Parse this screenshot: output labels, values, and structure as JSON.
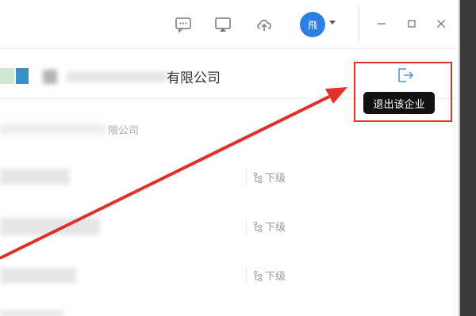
{
  "titlebar": {
    "icons": [
      "chat-icon",
      "screen-share-icon",
      "cloud-upload-icon"
    ],
    "avatar_text": "飛",
    "window_buttons": [
      "minimize-icon",
      "maximize-icon",
      "close-icon"
    ]
  },
  "company": {
    "name_suffix": "有限公司",
    "exit_tooltip": "退出该企业"
  },
  "list": {
    "sub_company_suffix": "限公司",
    "rows": [
      {
        "link_label": "下级"
      },
      {
        "link_label": "下级"
      },
      {
        "link_label": "下级"
      }
    ]
  },
  "colors": {
    "accent": "#2d7fe6",
    "annotation": "#e0302a",
    "tooltip_bg": "#111111"
  }
}
